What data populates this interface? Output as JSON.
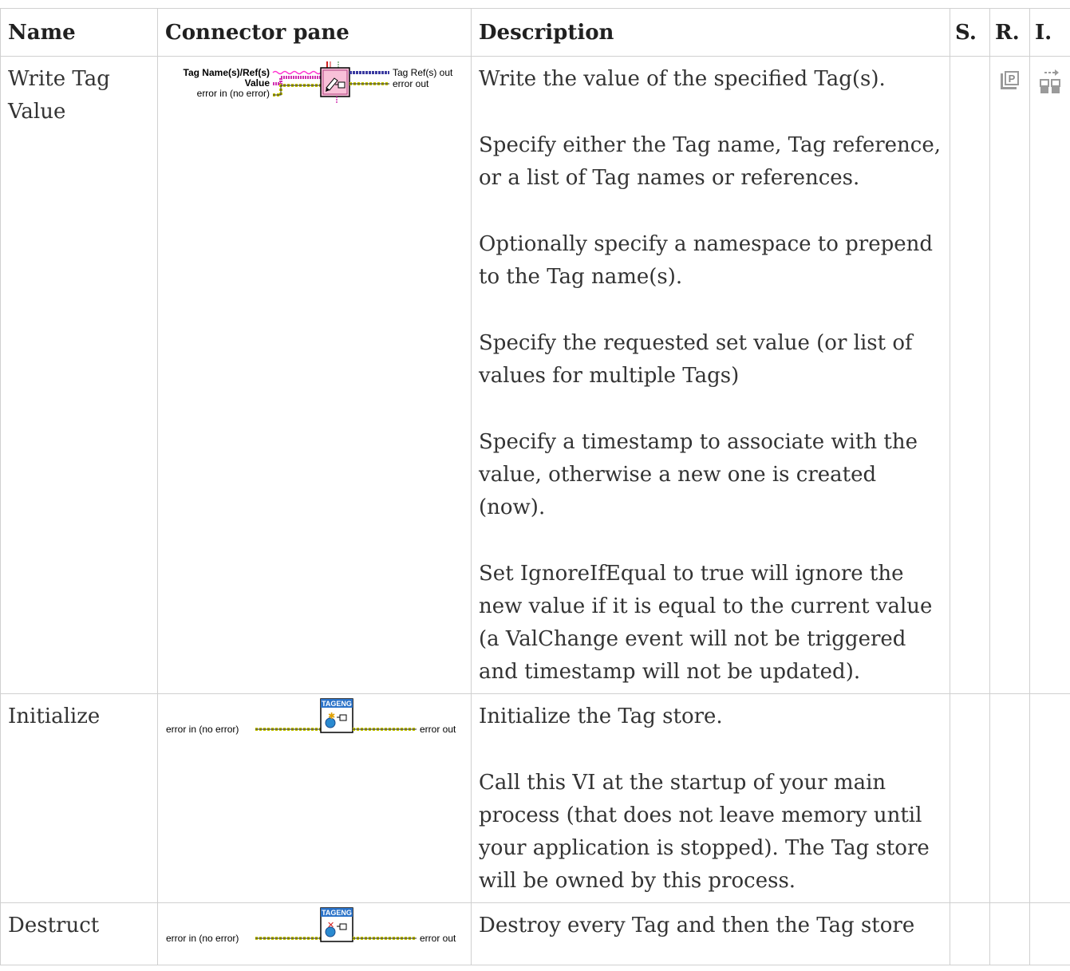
{
  "header": {
    "name": "Name",
    "connector": "Connector pane",
    "description": "Description",
    "s": "S.",
    "r": "R.",
    "i": "I."
  },
  "rows": [
    {
      "name": "Write Tag Value",
      "connector": {
        "in1": "Tag Name(s)/Ref(s)",
        "in2": "Value",
        "in3": "error in (no error)",
        "out1": "Tag Ref(s) out",
        "out2": "error out"
      },
      "description": [
        "Write the value of the specified Tag(s).",
        "Specify either the Tag name, Tag reference, or a list of Tag names or references.",
        "Optionally specify a namespace to prepend to the Tag name(s).",
        "Specify the requested set value (or list of values for multiple Tags)",
        "Specify a timestamp to associate with the value, otherwise a new one is created (now).",
        "Set IgnoreIfEqual to true will ignore the new value if it is equal to the current value (a ValChange event will not be triggered and timestamp will not be updated)."
      ],
      "icons": {
        "r": "reentrant-icon",
        "i": "inline-icon"
      }
    },
    {
      "name": "Initialize",
      "connector": {
        "in": "error in (no error)",
        "out": "error out",
        "banner": "TAGENG"
      },
      "description": [
        "Initialize the Tag store.",
        "Call this VI at the startup of your main process (that does not leave memory until your application is stopped). The Tag store will be owned by this process."
      ]
    },
    {
      "name": "Destruct",
      "connector": {
        "in": "error in (no error)",
        "out": "error out",
        "banner": "TAGENG"
      },
      "description": [
        "Destroy every Tag and then the Tag store"
      ]
    }
  ],
  "colors": {
    "error_wire": "#c8c800",
    "ref_wire": "#3a3aa0",
    "string_wire": "#ff30d0",
    "banner_blue": "#2a72c8",
    "icon_pink": "#f8c0d8",
    "border": "#d0d0d0"
  }
}
